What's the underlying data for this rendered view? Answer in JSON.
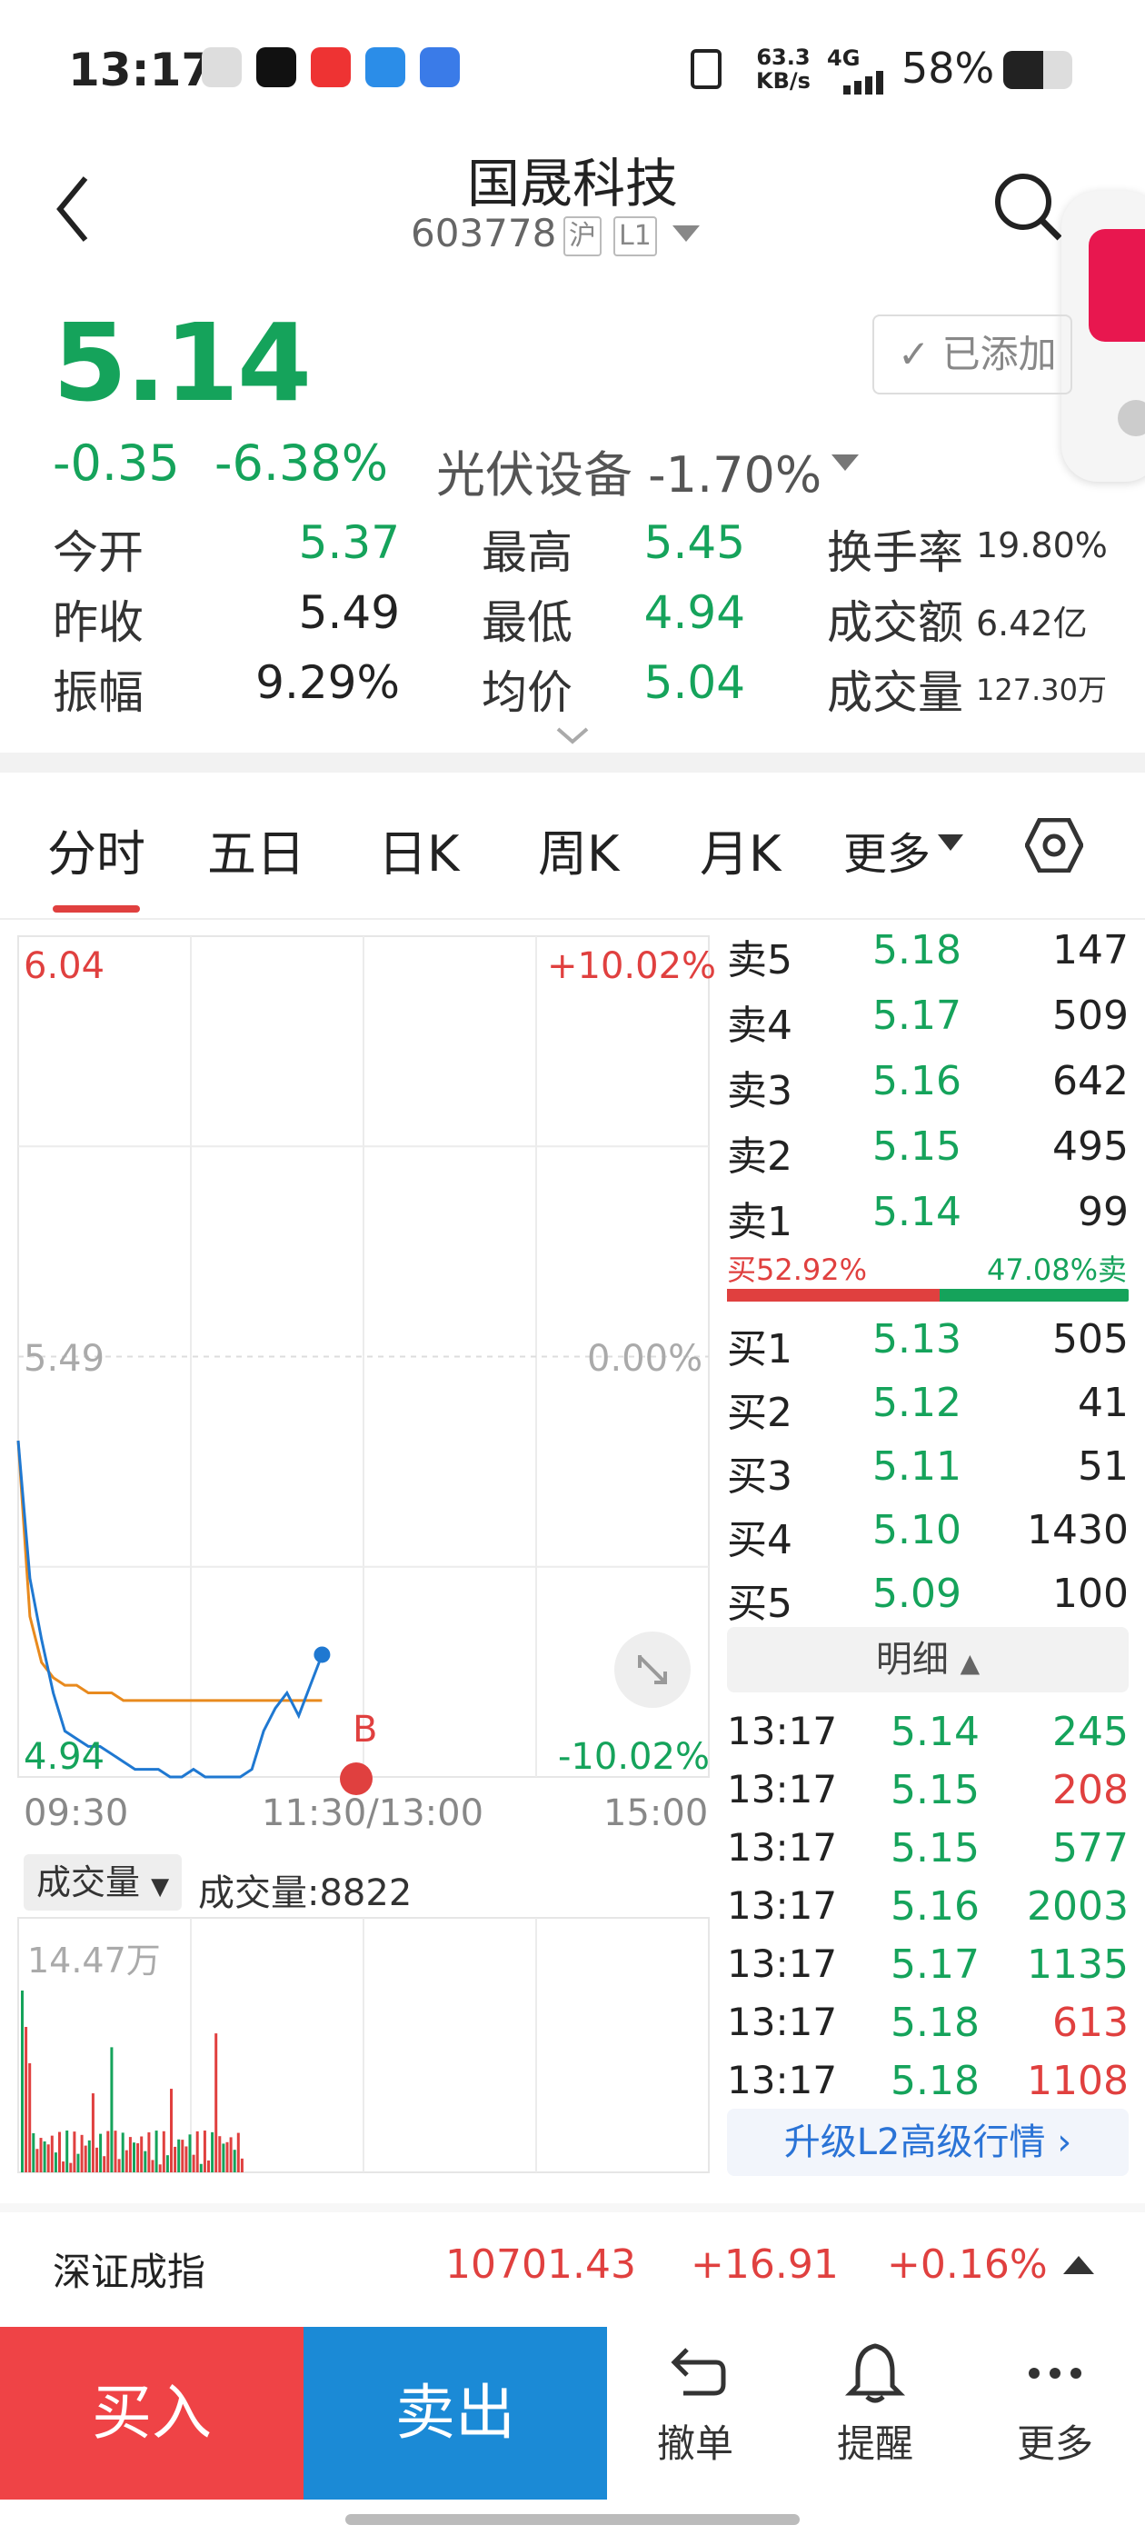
{
  "status_bar": {
    "time": "13:17",
    "net_speed_top": "63.3",
    "net_speed_bottom": "KB/s",
    "network": "4G",
    "battery": "58%"
  },
  "header": {
    "title": "国晟科技",
    "code": "603778",
    "exchange_tag": "沪",
    "level_tag": "L1",
    "added_label": "已添加"
  },
  "quote": {
    "price": "5.14",
    "change": "-0.35",
    "change_pct": "-6.38%",
    "sector": "光伏设备 -1.70%",
    "open_label": "今开",
    "open": "5.37",
    "prev_close_label": "昨收",
    "prev_close": "5.49",
    "amplitude_label": "振幅",
    "amplitude": "9.29%",
    "high_label": "最高",
    "high": "5.45",
    "low_label": "最低",
    "low": "4.94",
    "avg_label": "均价",
    "avg": "5.04",
    "turnover_label": "换手率",
    "turnover": "19.80%",
    "amount_label": "成交额",
    "amount": "6.42亿",
    "volume_label": "成交量",
    "volume": "127.30万"
  },
  "tabs": [
    "分时",
    "五日",
    "日K",
    "周K",
    "月K",
    "更多"
  ],
  "intraday": {
    "y_max": "6.04",
    "y_max_pct": "+10.02%",
    "y_mid": "5.49",
    "y_mid_pct": "0.00%",
    "y_min": "4.94",
    "y_min_pct": "-10.02%",
    "x_start": "09:30",
    "x_mid": "11:30/13:00",
    "x_end": "15:00",
    "marker": "B",
    "volume_selector": "成交量",
    "volume_text": "成交量:8822",
    "volume_max": "14.47万"
  },
  "chart_data": {
    "type": "line",
    "title": "",
    "series": [
      {
        "values": [
          5.38,
          5.2,
          5.12,
          5.05,
          5.0,
          4.99,
          4.98,
          4.98,
          4.97,
          4.96,
          4.95,
          4.95,
          4.95,
          4.94,
          4.94,
          4.95,
          4.94,
          4.94,
          4.94,
          4.94,
          4.95,
          5.0,
          5.03,
          5.05,
          5.02,
          5.06,
          5.1
        ]
      },
      {
        "values": [
          5.38,
          5.15,
          5.09,
          5.07,
          5.06,
          5.06,
          5.05,
          5.05,
          5.05,
          5.04,
          5.04,
          5.04,
          5.04,
          5.04,
          5.04,
          5.04,
          5.04,
          5.04,
          5.04,
          5.04,
          5.04,
          5.04,
          5.04,
          5.04,
          5.04,
          5.04,
          5.04
        ]
      }
    ],
    "ylim": [
      4.94,
      6.04
    ],
    "reference": 5.49,
    "volume_max": 144700
  },
  "order_book": {
    "asks": [
      {
        "label": "卖5",
        "price": "5.18",
        "vol": "147"
      },
      {
        "label": "卖4",
        "price": "5.17",
        "vol": "509"
      },
      {
        "label": "卖3",
        "price": "5.16",
        "vol": "642"
      },
      {
        "label": "卖2",
        "price": "5.15",
        "vol": "495"
      },
      {
        "label": "卖1",
        "price": "5.14",
        "vol": "99"
      }
    ],
    "buy_ratio": "买52.92%",
    "sell_ratio": "47.08%卖",
    "buy_ratio_value": 0.5292,
    "bids": [
      {
        "label": "买1",
        "price": "5.13",
        "vol": "505"
      },
      {
        "label": "买2",
        "price": "5.12",
        "vol": "41"
      },
      {
        "label": "买3",
        "price": "5.11",
        "vol": "51"
      },
      {
        "label": "买4",
        "price": "5.10",
        "vol": "1430"
      },
      {
        "label": "买5",
        "price": "5.09",
        "vol": "100"
      }
    ],
    "detail_label": "明细",
    "ticks": [
      {
        "time": "13:17",
        "price": "5.14",
        "vol": "245",
        "color": "green"
      },
      {
        "time": "13:17",
        "price": "5.15",
        "vol": "208",
        "color": "red"
      },
      {
        "time": "13:17",
        "price": "5.15",
        "vol": "577",
        "color": "green"
      },
      {
        "time": "13:17",
        "price": "5.16",
        "vol": "2003",
        "color": "green"
      },
      {
        "time": "13:17",
        "price": "5.17",
        "vol": "1135",
        "color": "green"
      },
      {
        "time": "13:17",
        "price": "5.18",
        "vol": "613",
        "color": "red"
      },
      {
        "time": "13:17",
        "price": "5.18",
        "vol": "1108",
        "color": "red"
      }
    ],
    "upgrade_label": "升级L2高级行情 ›"
  },
  "index_bar": {
    "name": "深证成指",
    "value": "10701.43",
    "change": "+16.91",
    "pct": "+0.16%"
  },
  "bottom_bar": {
    "buy": "买入",
    "sell": "卖出",
    "cancel": "撤单",
    "alert": "提醒",
    "more": "更多"
  }
}
